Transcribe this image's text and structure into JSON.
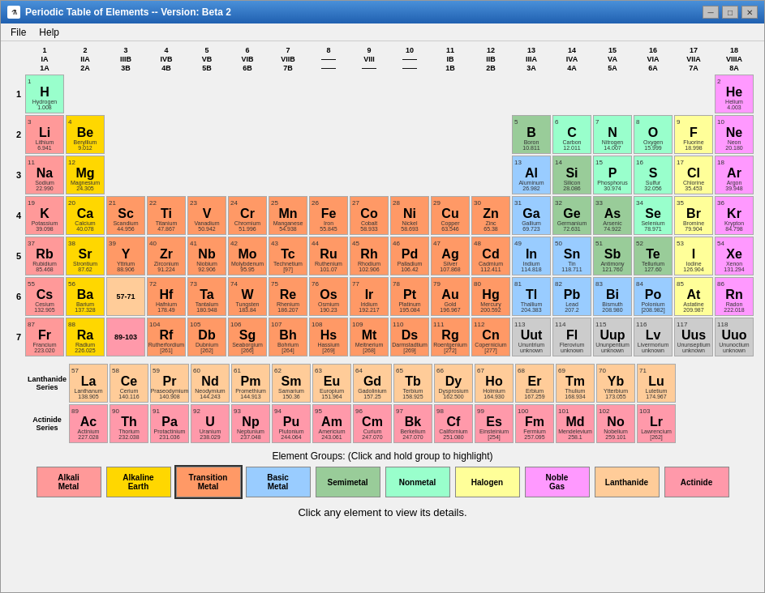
{
  "window": {
    "title": "Periodic Table of Elements  -- Version: Beta 2",
    "menu": [
      "File",
      "Help"
    ]
  },
  "groups_header": {
    "col1": {
      "line1": "1",
      "line2": "IA",
      "line3": "1A"
    },
    "col18": {
      "line1": "18",
      "line2": "VIIIA",
      "line3": "8A"
    },
    "col2": {
      "line1": "2",
      "line2": "IIA",
      "line3": "2A"
    },
    "col13": {
      "line1": "13",
      "line2": "IIIA",
      "line3": "3A"
    },
    "col14": {
      "line1": "14",
      "line2": "IVA",
      "line3": "4A"
    },
    "col15": {
      "line1": "15",
      "line2": "VA",
      "line3": "5A"
    },
    "col16": {
      "line1": "16",
      "line2": "VIA",
      "line3": "6A"
    },
    "col17": {
      "line1": "17",
      "line2": "VIIA",
      "line3": "7A"
    },
    "col3": {
      "line1": "3",
      "line2": "IIIB",
      "line3": "3B"
    },
    "col4": {
      "line1": "4",
      "line2": "IVB",
      "line3": "4B"
    },
    "col5": {
      "line1": "5",
      "line2": "VB",
      "line3": "5B"
    },
    "col6": {
      "line1": "6",
      "line2": "VIB",
      "line3": "6B"
    },
    "col7": {
      "line1": "7",
      "line2": "VIIB",
      "line3": "7B"
    },
    "col8": {
      "line1": "8",
      "line2": "——",
      "line3": "——"
    },
    "col9": {
      "line1": "9",
      "line2": "VIII",
      "line3": "——"
    },
    "col10": {
      "line1": "10",
      "line2": "——",
      "line3": "——"
    },
    "col11": {
      "line1": "11",
      "line2": "IB",
      "line3": "1B"
    },
    "col12": {
      "line1": "12",
      "line2": "IIB",
      "line3": "2B"
    }
  },
  "elements": {
    "H": {
      "num": 1,
      "symbol": "H",
      "name": "Hydrogen",
      "mass": "1.008",
      "group": "nonmetal"
    },
    "He": {
      "num": 2,
      "symbol": "He",
      "name": "Helium",
      "mass": "4.003",
      "group": "noble"
    },
    "Li": {
      "num": 3,
      "symbol": "Li",
      "name": "Lithium",
      "mass": "6.941",
      "group": "alkali"
    },
    "Be": {
      "num": 4,
      "symbol": "Be",
      "name": "Beryllium",
      "mass": "9.012",
      "group": "alkaline"
    },
    "B": {
      "num": 5,
      "symbol": "B",
      "name": "Boron",
      "mass": "10.811",
      "group": "semimetal"
    },
    "C": {
      "num": 6,
      "symbol": "C",
      "name": "Carbon",
      "mass": "12.011",
      "group": "nonmetal"
    },
    "N": {
      "num": 7,
      "symbol": "N",
      "name": "Nitrogen",
      "mass": "14.007",
      "group": "nonmetal"
    },
    "O": {
      "num": 8,
      "symbol": "O",
      "name": "Oxygen",
      "mass": "15.999",
      "group": "nonmetal"
    },
    "F": {
      "num": 9,
      "symbol": "F",
      "name": "Fluorine",
      "mass": "18.998",
      "group": "halogen"
    },
    "Ne": {
      "num": 10,
      "symbol": "Ne",
      "name": "Neon",
      "mass": "20.180",
      "group": "noble"
    },
    "Na": {
      "num": 11,
      "symbol": "Na",
      "name": "Sodium",
      "mass": "22.990",
      "group": "alkali"
    },
    "Mg": {
      "num": 12,
      "symbol": "Mg",
      "name": "Magnesium",
      "mass": "24.305",
      "group": "alkaline"
    },
    "Al": {
      "num": 13,
      "symbol": "Al",
      "name": "Aluminum",
      "mass": "26.982",
      "group": "basic-metal"
    },
    "Si": {
      "num": 14,
      "symbol": "Si",
      "name": "Silicon",
      "mass": "28.086",
      "group": "semimetal"
    },
    "P": {
      "num": 15,
      "symbol": "P",
      "name": "Phosphorus",
      "mass": "30.974",
      "group": "nonmetal"
    },
    "S": {
      "num": 16,
      "symbol": "S",
      "name": "Sulfur",
      "mass": "32.056",
      "group": "nonmetal"
    },
    "Cl": {
      "num": 17,
      "symbol": "Cl",
      "name": "Chlorine",
      "mass": "35.453",
      "group": "halogen"
    },
    "Ar": {
      "num": 18,
      "symbol": "Ar",
      "name": "Argon",
      "mass": "39.948",
      "group": "noble"
    },
    "K": {
      "num": 19,
      "symbol": "K",
      "name": "Potassium",
      "mass": "39.098",
      "group": "alkali"
    },
    "Ca": {
      "num": 20,
      "symbol": "Ca",
      "name": "Calcium",
      "mass": "40.078",
      "group": "alkaline"
    },
    "Sc": {
      "num": 21,
      "symbol": "Sc",
      "name": "Scandium",
      "mass": "44.956",
      "group": "transition"
    },
    "Ti": {
      "num": 22,
      "symbol": "Ti",
      "name": "Titanium",
      "mass": "47.867",
      "group": "transition"
    },
    "V": {
      "num": 23,
      "symbol": "V",
      "name": "Vanadium",
      "mass": "50.942",
      "group": "transition"
    },
    "Cr": {
      "num": 24,
      "symbol": "Cr",
      "name": "Chromium",
      "mass": "51.996",
      "group": "transition"
    },
    "Mn": {
      "num": 25,
      "symbol": "Mn",
      "name": "Manganese",
      "mass": "54.938",
      "group": "transition"
    },
    "Fe": {
      "num": 26,
      "symbol": "Fe",
      "name": "Iron",
      "mass": "55.845",
      "group": "transition"
    },
    "Co": {
      "num": 27,
      "symbol": "Co",
      "name": "Cobalt",
      "mass": "58.933",
      "group": "transition"
    },
    "Ni": {
      "num": 28,
      "symbol": "Ni",
      "name": "Nickel",
      "mass": "58.693",
      "group": "transition"
    },
    "Cu": {
      "num": 29,
      "symbol": "Cu",
      "name": "Copper",
      "mass": "63.546",
      "group": "transition"
    },
    "Zn": {
      "num": 30,
      "symbol": "Zn",
      "name": "Zinc",
      "mass": "65.38",
      "group": "transition"
    },
    "Ga": {
      "num": 31,
      "symbol": "Ga",
      "name": "Gallium",
      "mass": "69.723",
      "group": "basic-metal"
    },
    "Ge": {
      "num": 32,
      "symbol": "Ge",
      "name": "Germanium",
      "mass": "72.631",
      "group": "semimetal"
    },
    "As": {
      "num": 33,
      "symbol": "As",
      "name": "Arsenic",
      "mass": "74.922",
      "group": "semimetal"
    },
    "Se": {
      "num": 34,
      "symbol": "Se",
      "name": "Selenium",
      "mass": "78.971",
      "group": "nonmetal"
    },
    "Br": {
      "num": 35,
      "symbol": "Br",
      "name": "Bromine",
      "mass": "79.904",
      "group": "halogen"
    },
    "Kr": {
      "num": 36,
      "symbol": "Kr",
      "name": "Krypton",
      "mass": "84.798",
      "group": "noble"
    },
    "Rb": {
      "num": 37,
      "symbol": "Rb",
      "name": "Rubidium",
      "mass": "85.468",
      "group": "alkali"
    },
    "Sr": {
      "num": 38,
      "symbol": "Sr",
      "name": "Strontium",
      "mass": "87.62",
      "group": "alkaline"
    },
    "Y": {
      "num": 39,
      "symbol": "Y",
      "name": "Yttrium",
      "mass": "88.906",
      "group": "transition"
    },
    "Zr": {
      "num": 40,
      "symbol": "Zr",
      "name": "Zirconium",
      "mass": "91.224",
      "group": "transition"
    },
    "Nb": {
      "num": 41,
      "symbol": "Nb",
      "name": "Niobium",
      "mass": "92.906",
      "group": "transition"
    },
    "Mo": {
      "num": 42,
      "symbol": "Mo",
      "name": "Molybdenum",
      "mass": "95.95",
      "group": "transition"
    },
    "Tc": {
      "num": 43,
      "symbol": "Tc",
      "name": "Technetium",
      "mass": "[97]",
      "group": "transition"
    },
    "Ru": {
      "num": 44,
      "symbol": "Ru",
      "name": "Ruthenium",
      "mass": "101.07",
      "group": "transition"
    },
    "Rh": {
      "num": 45,
      "symbol": "Rh",
      "name": "Rhodium",
      "mass": "102.906",
      "group": "transition"
    },
    "Pd": {
      "num": 46,
      "symbol": "Pd",
      "name": "Palladium",
      "mass": "106.42",
      "group": "transition"
    },
    "Ag": {
      "num": 47,
      "symbol": "Ag",
      "name": "Silver",
      "mass": "107.868",
      "group": "transition"
    },
    "Cd": {
      "num": 48,
      "symbol": "Cd",
      "name": "Cadmium",
      "mass": "112.411",
      "group": "transition"
    },
    "In": {
      "num": 49,
      "symbol": "In",
      "name": "Indium",
      "mass": "114.818",
      "group": "basic-metal"
    },
    "Sn": {
      "num": 50,
      "symbol": "Sn",
      "name": "Tin",
      "mass": "118.711",
      "group": "basic-metal"
    },
    "Sb": {
      "num": 51,
      "symbol": "Sb",
      "name": "Antimony",
      "mass": "121.760",
      "group": "semimetal"
    },
    "Te": {
      "num": 52,
      "symbol": "Te",
      "name": "Tellurium",
      "mass": "127.60",
      "group": "semimetal"
    },
    "I": {
      "num": 53,
      "symbol": "I",
      "name": "Iodine",
      "mass": "126.904",
      "group": "halogen"
    },
    "Xe": {
      "num": 54,
      "symbol": "Xe",
      "name": "Xenon",
      "mass": "131.294",
      "group": "noble"
    },
    "Cs": {
      "num": 55,
      "symbol": "Cs",
      "name": "Cesium",
      "mass": "132.905",
      "group": "alkali"
    },
    "Ba": {
      "num": 56,
      "symbol": "Ba",
      "name": "Barium",
      "mass": "137.328",
      "group": "alkaline"
    },
    "Hf": {
      "num": 72,
      "symbol": "Hf",
      "name": "Hafnium",
      "mass": "178.49",
      "group": "transition"
    },
    "Ta": {
      "num": 73,
      "symbol": "Ta",
      "name": "Tantalum",
      "mass": "180.948",
      "group": "transition"
    },
    "W": {
      "num": 74,
      "symbol": "W",
      "name": "Tungsten",
      "mass": "183.84",
      "group": "transition"
    },
    "Re": {
      "num": 75,
      "symbol": "Re",
      "name": "Rhenium",
      "mass": "186.207",
      "group": "transition"
    },
    "Os": {
      "num": 76,
      "symbol": "Os",
      "name": "Osmium",
      "mass": "190.23",
      "group": "transition"
    },
    "Ir": {
      "num": 77,
      "symbol": "Ir",
      "name": "Iridium",
      "mass": "192.217",
      "group": "transition"
    },
    "Pt": {
      "num": 78,
      "symbol": "Pt",
      "name": "Platinum",
      "mass": "195.084",
      "group": "transition"
    },
    "Au": {
      "num": 79,
      "symbol": "Au",
      "name": "Gold",
      "mass": "196.967",
      "group": "transition"
    },
    "Hg": {
      "num": 80,
      "symbol": "Hg",
      "name": "Mercury",
      "mass": "200.592",
      "group": "transition"
    },
    "Tl": {
      "num": 81,
      "symbol": "Tl",
      "name": "Thallium",
      "mass": "204.383",
      "group": "basic-metal"
    },
    "Pb": {
      "num": 82,
      "symbol": "Pb",
      "name": "Lead",
      "mass": "207.2",
      "group": "basic-metal"
    },
    "Bi": {
      "num": 83,
      "symbol": "Bi",
      "name": "Bismuth",
      "mass": "208.980",
      "group": "basic-metal"
    },
    "Po": {
      "num": 84,
      "symbol": "Po",
      "name": "Polonium",
      "mass": "[208.982]",
      "group": "basic-metal"
    },
    "At": {
      "num": 85,
      "symbol": "At",
      "name": "Astatine",
      "mass": "209.987",
      "group": "halogen"
    },
    "Rn": {
      "num": 86,
      "symbol": "Rn",
      "name": "Radon",
      "mass": "222.018",
      "group": "noble"
    },
    "Fr": {
      "num": 87,
      "symbol": "Fr",
      "name": "Francium",
      "mass": "223.020",
      "group": "alkali"
    },
    "Ra": {
      "num": 88,
      "symbol": "Ra",
      "name": "Radium",
      "mass": "226.025",
      "group": "alkaline"
    },
    "Rf": {
      "num": 104,
      "symbol": "Rf",
      "name": "Rutherfordium",
      "mass": "[261]",
      "group": "transition"
    },
    "Db": {
      "num": 105,
      "symbol": "Db",
      "name": "Dubnium",
      "mass": "[262]",
      "group": "transition"
    },
    "Sg": {
      "num": 106,
      "symbol": "Sg",
      "name": "Seaborgium",
      "mass": "[266]",
      "group": "transition"
    },
    "Bh": {
      "num": 107,
      "symbol": "Bh",
      "name": "Bohrium",
      "mass": "[264]",
      "group": "transition"
    },
    "Hs": {
      "num": 108,
      "symbol": "Hs",
      "name": "Hassium",
      "mass": "[269]",
      "group": "transition"
    },
    "Mt": {
      "num": 109,
      "symbol": "Mt",
      "name": "Meitnerium",
      "mass": "[268]",
      "group": "transition"
    },
    "Ds": {
      "num": 110,
      "symbol": "Ds",
      "name": "Darmstadtium",
      "mass": "[269]",
      "group": "transition"
    },
    "Rg": {
      "num": 111,
      "symbol": "Rg",
      "name": "Roentgenium",
      "mass": "[272]",
      "group": "transition"
    },
    "Cn": {
      "num": 112,
      "symbol": "Cn",
      "name": "Copernicium",
      "mass": "[277]",
      "group": "transition"
    },
    "Uut": {
      "num": 113,
      "symbol": "Uut",
      "name": "Ununtrium",
      "mass": "unknown",
      "group": "unknown"
    },
    "Fl": {
      "num": 114,
      "symbol": "Fl",
      "name": "Flerovium",
      "mass": "unknown",
      "group": "unknown"
    },
    "Uup": {
      "num": 115,
      "symbol": "Uup",
      "name": "Ununpentium",
      "mass": "unknown",
      "group": "unknown"
    },
    "Lv": {
      "num": 116,
      "symbol": "Lv",
      "name": "Livermorium",
      "mass": "unknown",
      "group": "unknown"
    },
    "Uus": {
      "num": 117,
      "symbol": "Uus",
      "name": "Ununseptium",
      "mass": "unknown",
      "group": "unknown"
    },
    "Uuo": {
      "num": 118,
      "symbol": "Uuo",
      "name": "Ununoctium",
      "mass": "unknown",
      "group": "unknown"
    },
    "La": {
      "num": 57,
      "symbol": "La",
      "name": "Lanthanum",
      "mass": "138.905",
      "group": "lanthanide"
    },
    "Ce": {
      "num": 58,
      "symbol": "Ce",
      "name": "Cerium",
      "mass": "140.116",
      "group": "lanthanide"
    },
    "Pr": {
      "num": 59,
      "symbol": "Pr",
      "name": "Praseodymium",
      "mass": "140.908",
      "group": "lanthanide"
    },
    "Nd": {
      "num": 60,
      "symbol": "Nd",
      "name": "Neodymium",
      "mass": "144.243",
      "group": "lanthanide"
    },
    "Pm": {
      "num": 61,
      "symbol": "Pm",
      "name": "Promethium",
      "mass": "144.913",
      "group": "lanthanide"
    },
    "Sm": {
      "num": 62,
      "symbol": "Sm",
      "name": "Samarium",
      "mass": "150.36",
      "group": "lanthanide"
    },
    "Eu": {
      "num": 63,
      "symbol": "Eu",
      "name": "Europium",
      "mass": "151.964",
      "group": "lanthanide"
    },
    "Gd": {
      "num": 64,
      "symbol": "Gd",
      "name": "Gadolinium",
      "mass": "157.25",
      "group": "lanthanide"
    },
    "Tb": {
      "num": 65,
      "symbol": "Tb",
      "name": "Terbium",
      "mass": "158.925",
      "group": "lanthanide"
    },
    "Dy": {
      "num": 66,
      "symbol": "Dy",
      "name": "Dysprosium",
      "mass": "162.500",
      "group": "lanthanide"
    },
    "Ho": {
      "num": 67,
      "symbol": "Ho",
      "name": "Holmium",
      "mass": "164.930",
      "group": "lanthanide"
    },
    "Er": {
      "num": 68,
      "symbol": "Er",
      "name": "Erbium",
      "mass": "167.259",
      "group": "lanthanide"
    },
    "Tm": {
      "num": 69,
      "symbol": "Tm",
      "name": "Thulium",
      "mass": "168.934",
      "group": "lanthanide"
    },
    "Yb": {
      "num": 70,
      "symbol": "Yb",
      "name": "Ytterbium",
      "mass": "173.055",
      "group": "lanthanide"
    },
    "Lu": {
      "num": 71,
      "symbol": "Lu",
      "name": "Lutetium",
      "mass": "174.967",
      "group": "lanthanide"
    },
    "Ac": {
      "num": 89,
      "symbol": "Ac",
      "name": "Actinium",
      "mass": "227.028",
      "group": "actinide"
    },
    "Th": {
      "num": 90,
      "symbol": "Th",
      "name": "Thorium",
      "mass": "232.038",
      "group": "actinide"
    },
    "Pa": {
      "num": 91,
      "symbol": "Pa",
      "name": "Protactinium",
      "mass": "231.036",
      "group": "actinide"
    },
    "U": {
      "num": 92,
      "symbol": "U",
      "name": "Uranium",
      "mass": "238.029",
      "group": "actinide"
    },
    "Np": {
      "num": 93,
      "symbol": "Np",
      "name": "Neptunium",
      "mass": "237.048",
      "group": "actinide"
    },
    "Pu": {
      "num": 94,
      "symbol": "Pu",
      "name": "Plutonium",
      "mass": "244.064",
      "group": "actinide"
    },
    "Am": {
      "num": 95,
      "symbol": "Am",
      "name": "Americium",
      "mass": "243.061",
      "group": "actinide"
    },
    "Cm": {
      "num": 96,
      "symbol": "Cm",
      "name": "Curium",
      "mass": "247.070",
      "group": "actinide"
    },
    "Bk": {
      "num": 97,
      "symbol": "Bk",
      "name": "Berkelium",
      "mass": "247.070",
      "group": "actinide"
    },
    "Cf": {
      "num": 98,
      "symbol": "Cf",
      "name": "Californium",
      "mass": "251.080",
      "group": "actinide"
    },
    "Es": {
      "num": 99,
      "symbol": "Es",
      "name": "Einsteinium",
      "mass": "[254]",
      "group": "actinide"
    },
    "Fm": {
      "num": 100,
      "symbol": "Fm",
      "name": "Fermium",
      "mass": "257.095",
      "group": "actinide"
    },
    "Md": {
      "num": 101,
      "symbol": "Md",
      "name": "Mendelevium",
      "mass": "258.1",
      "group": "actinide"
    },
    "No": {
      "num": 102,
      "symbol": "No",
      "name": "Nobelium",
      "mass": "259.101",
      "group": "actinide"
    },
    "Lr": {
      "num": 103,
      "symbol": "Lr",
      "name": "Lawrencium",
      "mass": "[262]",
      "group": "actinide"
    }
  },
  "element_groups": [
    {
      "label": "Alkali\nMetal",
      "color": "#ff9999",
      "id": "alkali"
    },
    {
      "label": "Alkaline\nEarth",
      "color": "#ffd700",
      "id": "alkaline"
    },
    {
      "label": "Transition\nMetal",
      "color": "#ff9966",
      "id": "transition"
    },
    {
      "label": "Basic\nMetal",
      "color": "#99ccff",
      "id": "basic-metal"
    },
    {
      "label": "Semimetal",
      "color": "#99cc99",
      "id": "semimetal"
    },
    {
      "label": "Nonmetal",
      "color": "#99ffcc",
      "id": "nonmetal"
    },
    {
      "label": "Halogen",
      "color": "#ffff99",
      "id": "halogen"
    },
    {
      "label": "Noble\nGas",
      "color": "#ff99ff",
      "id": "noble"
    },
    {
      "label": "Lanthanide",
      "color": "#ffcc99",
      "id": "lanthanide"
    },
    {
      "label": "Actinide",
      "color": "#ff99aa",
      "id": "actinide"
    }
  ],
  "bottom_text": "Click any element to view its details.",
  "element_groups_label": "Element Groups:  (Click and hold group to highlight)"
}
